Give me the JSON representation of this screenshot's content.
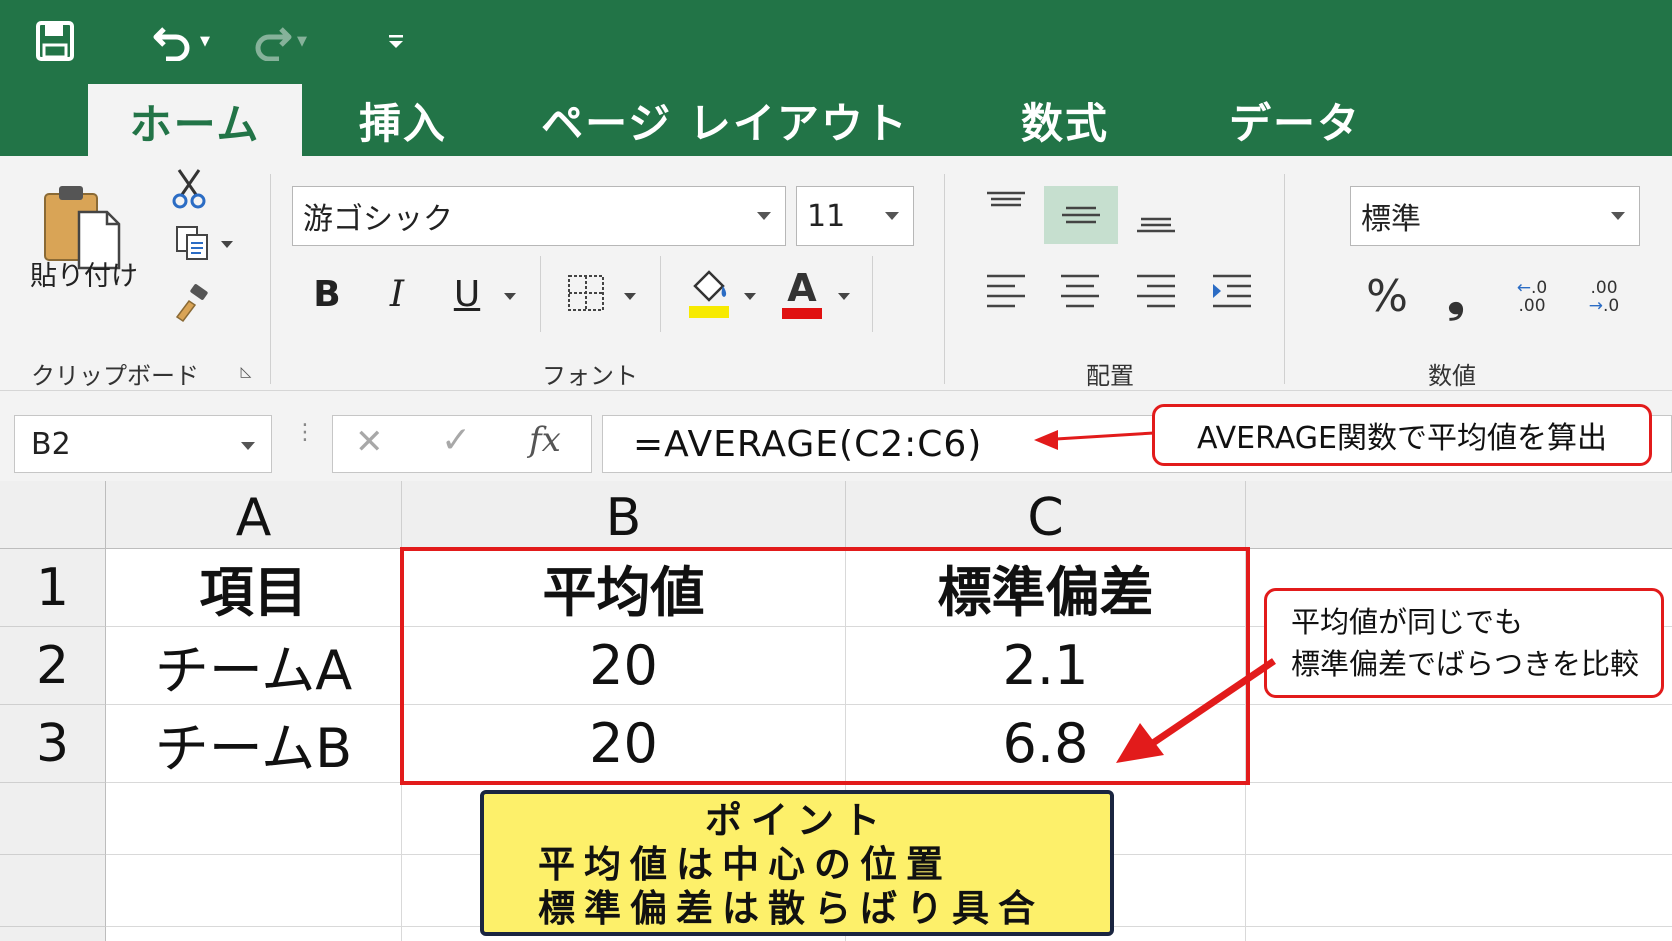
{
  "quick_access": {
    "save_icon": "save-icon",
    "undo_icon": "undo-icon",
    "redo_icon": "redo-icon",
    "customize_icon": "customize-qat-icon"
  },
  "tabs": [
    {
      "label": "ホーム",
      "active": true
    },
    {
      "label": "挿入",
      "active": false
    },
    {
      "label": "ページ レイアウト",
      "active": false
    },
    {
      "label": "数式",
      "active": false
    },
    {
      "label": "データ",
      "active": false
    }
  ],
  "ribbon": {
    "clipboard": {
      "paste_label": "貼り付け",
      "group_label": "クリップボード"
    },
    "font": {
      "font_name": "游ゴシック",
      "font_size": "11",
      "bold": "B",
      "italic": "I",
      "underline": "U",
      "font_color_letter": "A",
      "fill_color": "#f7ea00",
      "font_color": "#e01010",
      "group_label": "フォント"
    },
    "alignment": {
      "group_label": "配置"
    },
    "number": {
      "format": "標準",
      "percent": "%",
      "comma": "❟",
      "inc_decimal_top": ".0",
      "inc_decimal_bottom": ".00",
      "dec_decimal_top": ".00",
      "dec_decimal_bottom": ".0",
      "group_label": "数値"
    }
  },
  "formula_bar": {
    "name_box": "B2",
    "cancel": "✕",
    "enter": "✓",
    "fx": "fx",
    "formula": "=AVERAGE(C2:C6)"
  },
  "sheet": {
    "columns": [
      "A",
      "B",
      "C"
    ],
    "rows": [
      "1",
      "2",
      "3"
    ],
    "cells": [
      [
        "項目",
        "平均値",
        "標準偏差"
      ],
      [
        "チームA",
        "20",
        "2.1"
      ],
      [
        "チームB",
        "20",
        "6.8"
      ]
    ]
  },
  "annotations": {
    "formula_note": "AVERAGE関数で平均値を算出",
    "compare_note_line1": "平均値が同じでも",
    "compare_note_line2": "標準偏差でばらつきを比較",
    "point_title": "ポイント",
    "point_line1": "平均値は中心の位置",
    "point_line2": "標準偏差は散らばり具合"
  },
  "colors": {
    "excel_green": "#227447",
    "highlight_red": "#e21b1b",
    "point_yellow": "#fdf06a"
  }
}
